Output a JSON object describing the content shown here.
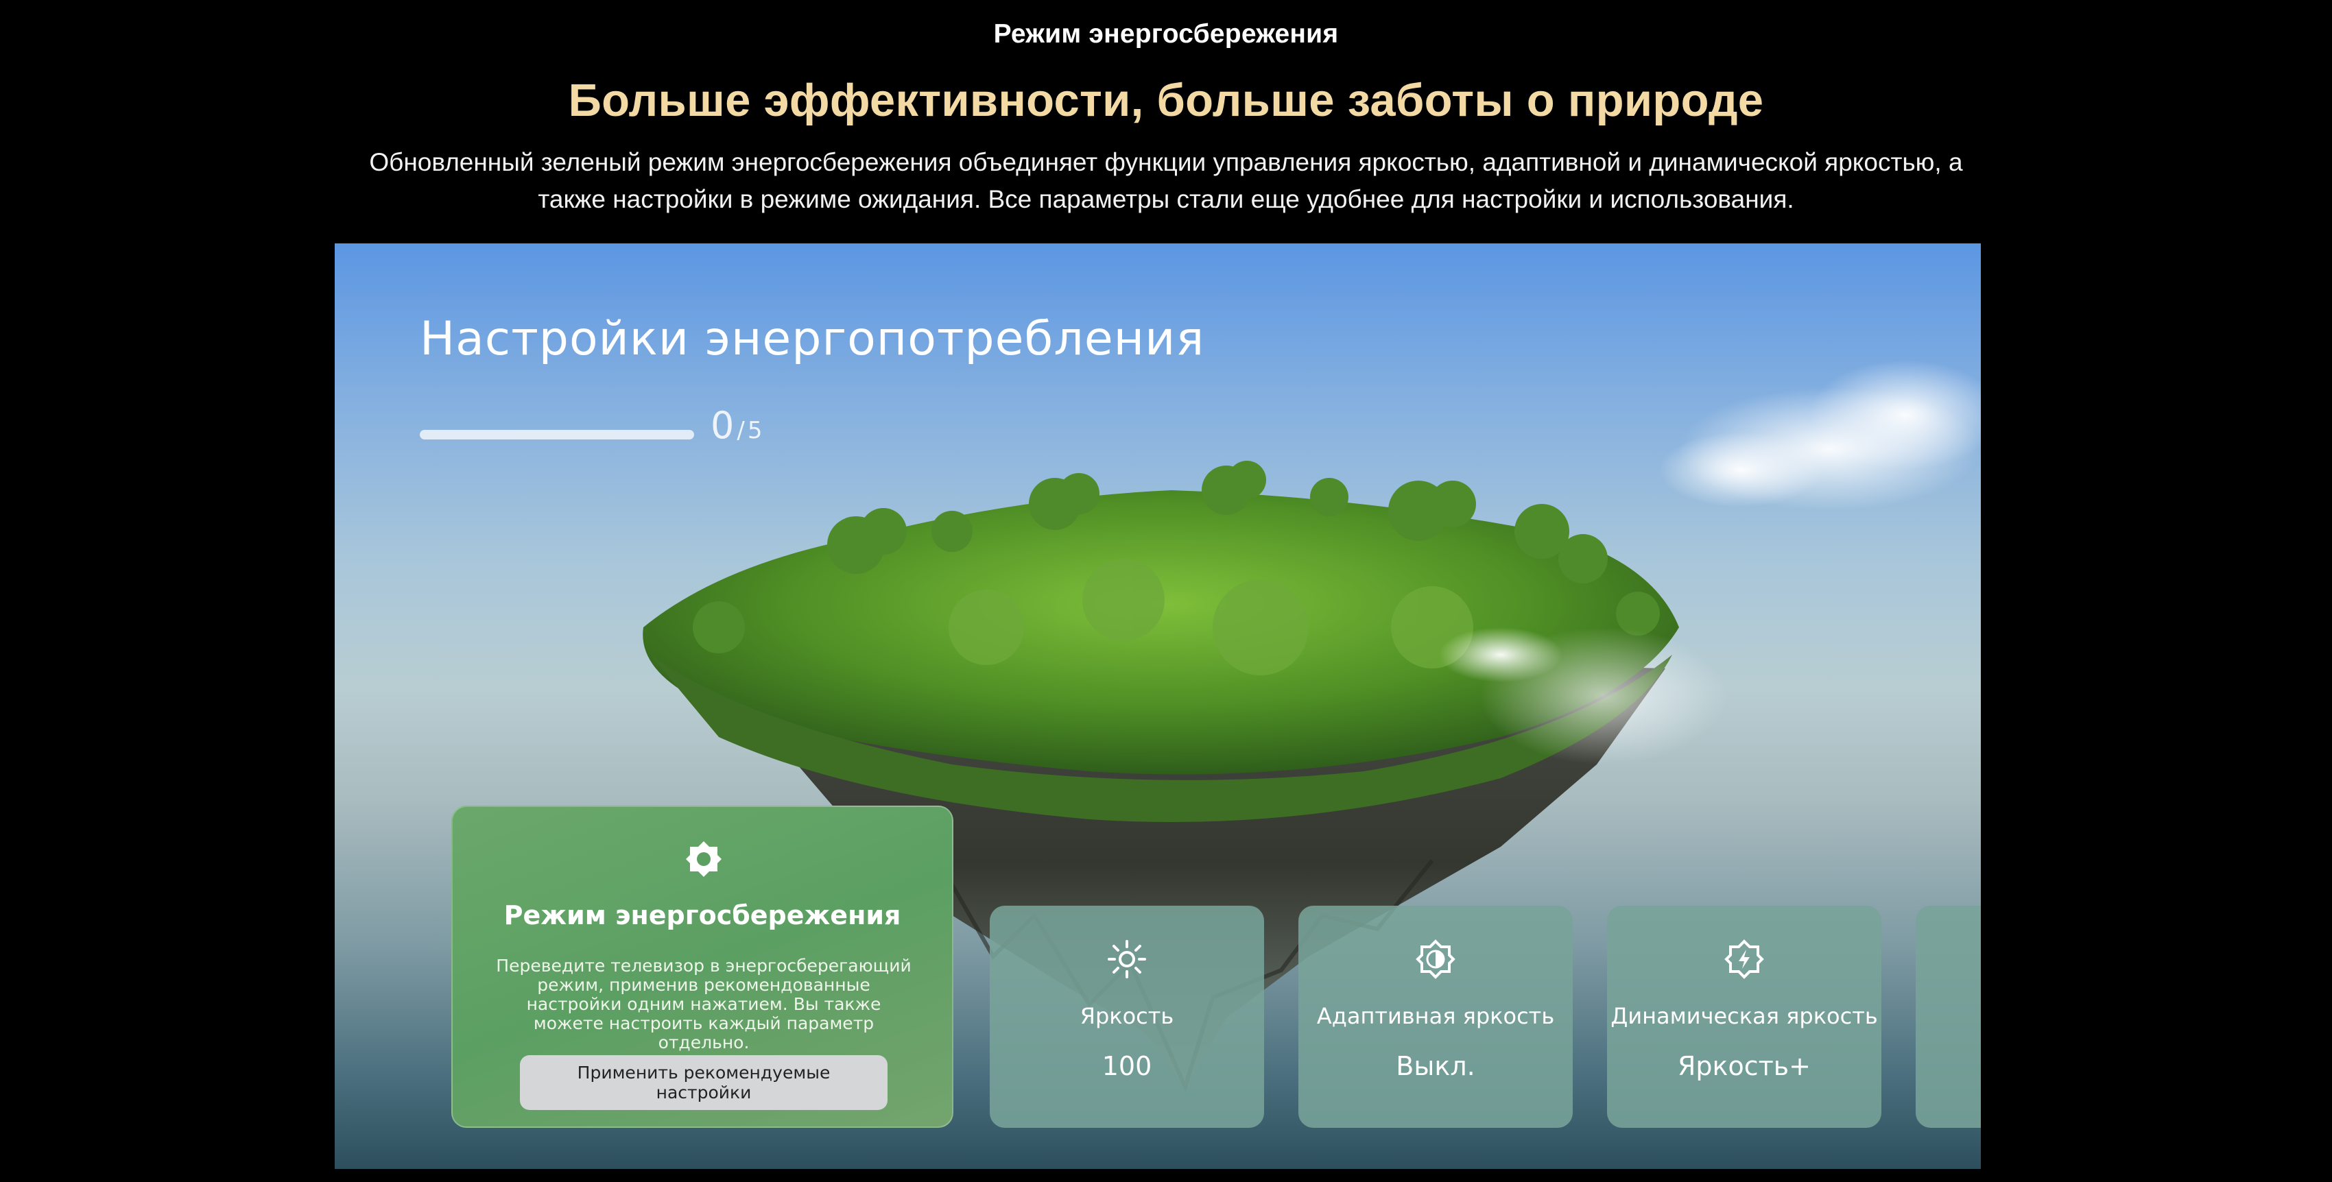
{
  "page": {
    "eyebrow": "Режим энергосбережения",
    "headline": "Больше эффективности, больше заботы о природе",
    "description": "Обновленный зеленый режим энергосбережения объединяет функции управления яркостью, адаптивной и динамической яркостью, а также настройки в режиме ожидания. Все параметры стали еще удобнее для настройки и использования."
  },
  "tv": {
    "title": "Настройки энергопотребления",
    "progress": {
      "current": "0",
      "separator": "/",
      "total": "5",
      "fraction": 0
    },
    "main_card": {
      "icon": "eco-badge-icon",
      "title": "Режим энергосбережения",
      "description": "Переведите телевизор в энергосберегающий режим, применив рекомендованные настройки одним нажатием. Вы также можете настроить каждый параметр отдельно.",
      "button_label": "Применить рекомендуемые настройки"
    },
    "settings": [
      {
        "icon": "sun-icon",
        "label": "Яркость",
        "value": "100"
      },
      {
        "icon": "adaptive-brightness-icon",
        "label": "Адаптивная яркость",
        "value": "Выкл."
      },
      {
        "icon": "dynamic-brightness-icon",
        "label": "Динамическая яркость",
        "value": "Яркость+"
      }
    ]
  },
  "colors": {
    "background": "#000000",
    "headline": "#f3d9a4",
    "main_card": "#5c9f63",
    "setting_card": "#78a398",
    "button": "#d5d6d8"
  }
}
